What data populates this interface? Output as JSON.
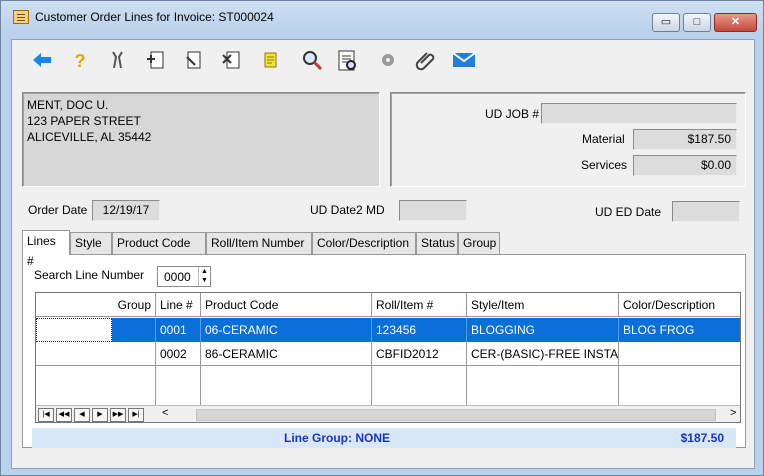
{
  "window": {
    "title": "Customer Order Lines for Invoice: ST000024",
    "min_glyph": "▭",
    "max_glyph": "□",
    "close_glyph": "✕"
  },
  "toolbar": {
    "icons": [
      "back-arrow-icon",
      "help-icon",
      "tools-icon",
      "add-document-icon",
      "edit-document-icon",
      "delete-document-icon",
      "note-icon",
      "search-icon",
      "print-preview-icon",
      "settings-icon",
      "attachment-icon",
      "email-icon"
    ]
  },
  "address": {
    "line1": "MENT, DOC U.",
    "line2": "123 PAPER STREET",
    "line3": "ALICEVILLE, AL  35442"
  },
  "summary": {
    "ud_job_label": "UD JOB #",
    "ud_job_value": "",
    "material_label": "Material",
    "material_value": "$187.50",
    "services_label": "Services",
    "services_value": "$0.00"
  },
  "dates": {
    "order_date_label": "Order Date",
    "order_date_value": "12/19/17",
    "ud_date2_label": "UD Date2 MD",
    "ud_date2_value": "",
    "ud_ed_label": "UD ED Date",
    "ud_ed_value": ""
  },
  "tabs": [
    "Lines #",
    "Style",
    "Product Code",
    "Roll/Item Number",
    "Color/Description",
    "Status",
    "Group"
  ],
  "search": {
    "label": "Search Line Number",
    "value": "0000"
  },
  "grid": {
    "columns": [
      "Group",
      "Line #",
      "Product Code",
      "Roll/Item #",
      "Style/Item",
      "Color/Description"
    ],
    "rows": [
      {
        "group": "",
        "line": "0001",
        "product": "06-CERAMIC",
        "roll": "123456",
        "style": "BLOGGING",
        "color": "BLOG FROG"
      },
      {
        "group": "",
        "line": "0002",
        "product": "86-CERAMIC",
        "roll": "CBFID2012",
        "style": "CER-(BASIC)-FREE INSTALLA",
        "color": ""
      }
    ],
    "nav": [
      "|◀",
      "◀◀",
      "◀",
      "▶",
      "▶▶",
      "▶|"
    ],
    "scroll_left": "<",
    "scroll_right": ">"
  },
  "footer": {
    "line_group": "Line Group: NONE",
    "total": "$187.50"
  }
}
